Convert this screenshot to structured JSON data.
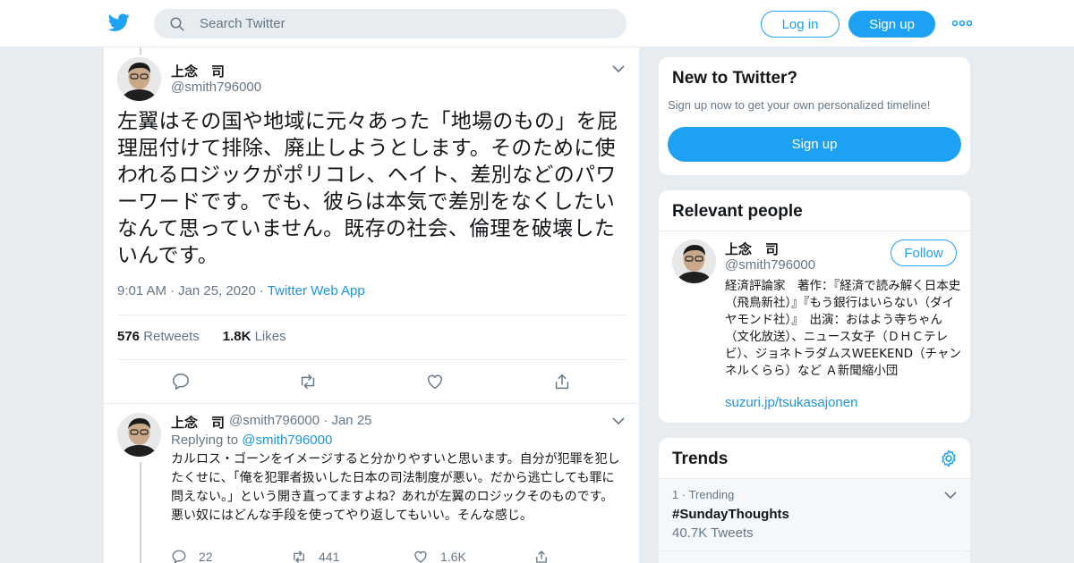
{
  "header": {
    "search_placeholder": "Search Twitter",
    "login_label": "Log in",
    "signup_label": "Sign up"
  },
  "tweet": {
    "display_name": "上念　司",
    "handle": "@smith796000",
    "text": "左翼はその国や地域に元々あった「地場のもの」を屁理屈付けて排除、廃止しようとします。そのために使われるロジックがポリコレ、ヘイト、差別などのパワーワードです。でも、彼らは本気で差別をなくしたいなんて思っていません。既存の社会、倫理を破壊したいんです。",
    "time": "9:01 AM",
    "date": "Jan 25, 2020",
    "source": "Twitter Web App",
    "retweets_count": "576",
    "retweets_label": "Retweets",
    "likes_count": "1.8K",
    "likes_label": "Likes"
  },
  "reply": {
    "display_name": "上念　司",
    "handle": "@smith796000",
    "date": "Jan 25",
    "replying_label": "Replying to",
    "replying_handle": "@smith796000",
    "text": "カルロス・ゴーンをイメージすると分かりやすいと思います。自分が犯罪を犯したくせに、「俺を犯罪者扱いした日本の司法制度が悪い。だから逃亡しても罪に問えない。」という開き直ってますよね？あれが左翼のロジックそのものです。悪い奴にはどんな手段を使ってやり返してもいい。そんな感じ。",
    "reply_count": "22",
    "retweet_count": "441",
    "like_count": "1.6K"
  },
  "new_to_twitter": {
    "title": "New to Twitter?",
    "subtitle": "Sign up now to get your own personalized timeline!",
    "button": "Sign up"
  },
  "relevant_people": {
    "title": "Relevant people",
    "display_name": "上念　司",
    "handle": "@smith796000",
    "follow_label": "Follow",
    "bio": "経済評論家　著作：『経済で読み解く日本史 （飛鳥新社）』『もう銀行はいらない（ダイヤモンド社）』　出演：おはよう寺ちゃん（文化放送）、ニュース女子（ＤＨＣテレビ）、ジョネトラダムスWEEKEND（チャンネルくらら）など Ａ新聞縮小団",
    "link": "suzuri.jp/tsukasajonen"
  },
  "trends": {
    "title": "Trends",
    "items": [
      {
        "rank": "1",
        "label": "Trending",
        "name": "#SundayThoughts",
        "count": "40.7K Tweets"
      }
    ]
  },
  "colors": {
    "brand": "#1da1f2",
    "link": "#1b95e0",
    "muted": "#657786",
    "background": "#e6ecf0"
  }
}
